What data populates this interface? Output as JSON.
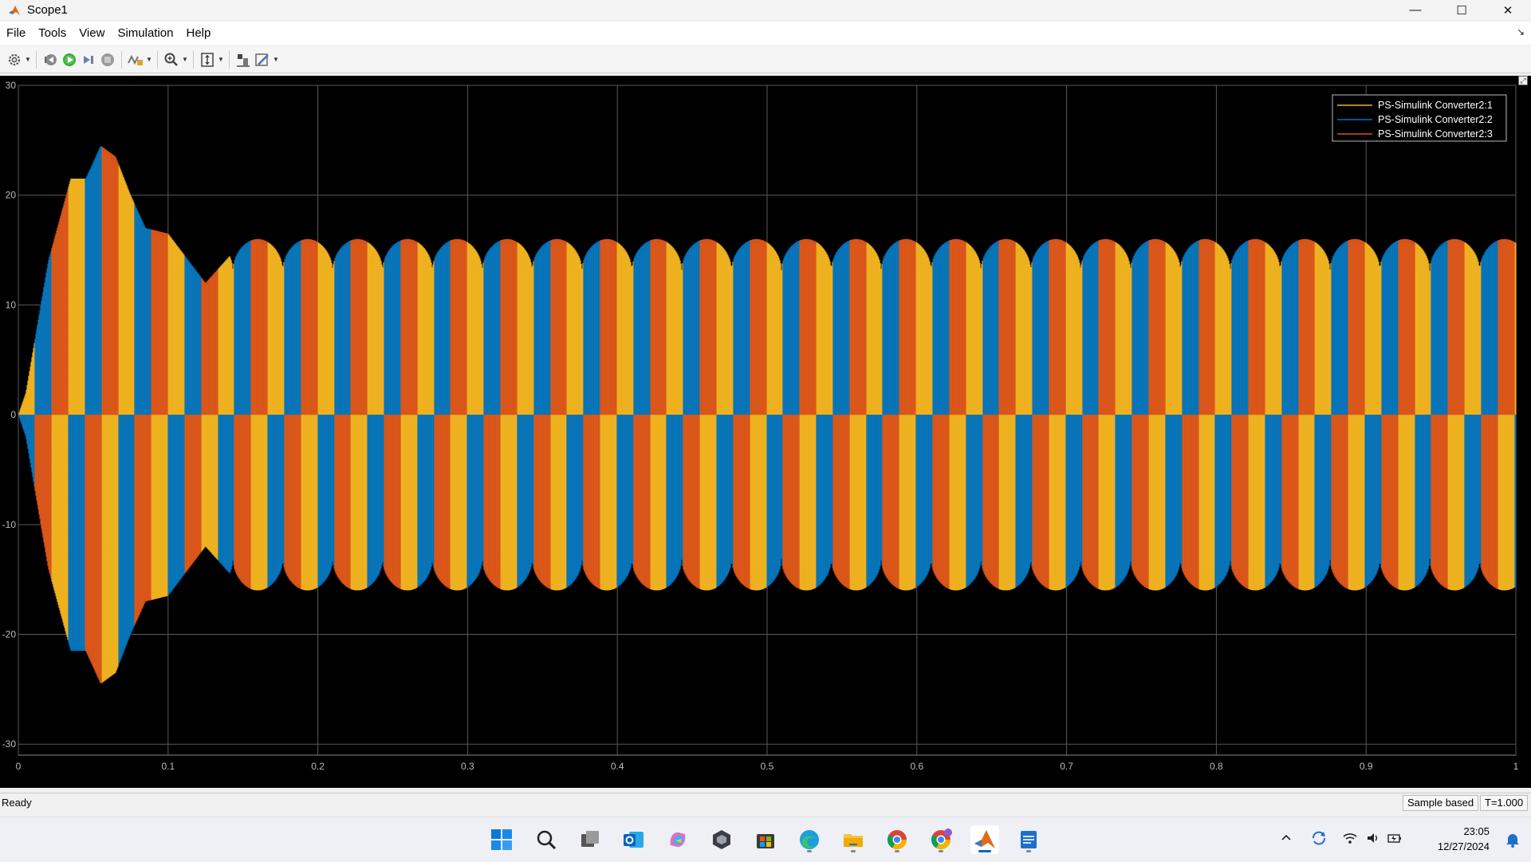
{
  "window": {
    "title": "Scope1",
    "controls": {
      "minimize": "—",
      "maximize": "☐",
      "close": "✕"
    }
  },
  "menubar": {
    "items": [
      "File",
      "Tools",
      "View",
      "Simulation",
      "Help"
    ]
  },
  "toolbar": {
    "icons": [
      "settings-icon",
      "step-back-icon",
      "run-icon",
      "step-forward-icon",
      "stop-icon",
      "signal-select-icon",
      "zoom-in-icon",
      "autoscale-icon",
      "highlight-icon",
      "style-icon"
    ]
  },
  "chart_data": {
    "type": "line",
    "title": "",
    "xlabel": "",
    "ylabel": "",
    "xlim": [
      0,
      1
    ],
    "ylim": [
      -31,
      30
    ],
    "xticks": [
      "0",
      "0.1",
      "0.2",
      "0.3",
      "0.4",
      "0.5",
      "0.6",
      "0.7",
      "0.8",
      "0.9",
      "1"
    ],
    "xtick_values": [
      0,
      0.1,
      0.2,
      0.3,
      0.4,
      0.5,
      0.6,
      0.7,
      0.8,
      0.9,
      1
    ],
    "yticks": [
      "30",
      "20",
      "10",
      "0",
      "-10",
      "-20",
      "-30"
    ],
    "ytick_values": [
      30,
      20,
      10,
      0,
      -10,
      -20,
      -30
    ],
    "grid": true,
    "background": "#000000",
    "legend_position": "top-right",
    "series": [
      {
        "name": "PS-Simulink Converter2:1",
        "color": "#EDB120"
      },
      {
        "name": "PS-Simulink Converter2:2",
        "color": "#0072BD"
      },
      {
        "name": "PS-Simulink Converter2:3",
        "color": "#D95319"
      }
    ],
    "envelope": {
      "t": [
        0,
        0.005,
        0.02,
        0.035,
        0.045,
        0.055,
        0.065,
        0.075,
        0.085,
        0.1,
        0.125,
        0.15,
        0.175,
        0.2,
        0.25,
        0.5,
        1.0
      ],
      "amplitude": [
        0,
        2,
        14,
        21.5,
        21.5,
        24.5,
        23.5,
        20,
        17,
        16.5,
        12,
        15.8,
        16.5,
        16,
        16,
        16,
        16
      ]
    },
    "steady_state_amplitude": 16,
    "ripple_min": 13,
    "ripple_period": 0.0333
  },
  "statusbar": {
    "status": "Ready",
    "mode": "Sample based",
    "time": "T=1.000"
  },
  "taskbar": {
    "apps": [
      "start-icon",
      "search-icon",
      "task-view-icon",
      "outlook-icon",
      "copilot-icon",
      "app-icon",
      "store-icon",
      "edge-icon",
      "file-explorer-icon",
      "chrome-icon",
      "chrome-profile-icon",
      "matlab-icon",
      "notepad-icon"
    ],
    "clock_time": "23:05",
    "clock_date": "12/27/2024"
  }
}
